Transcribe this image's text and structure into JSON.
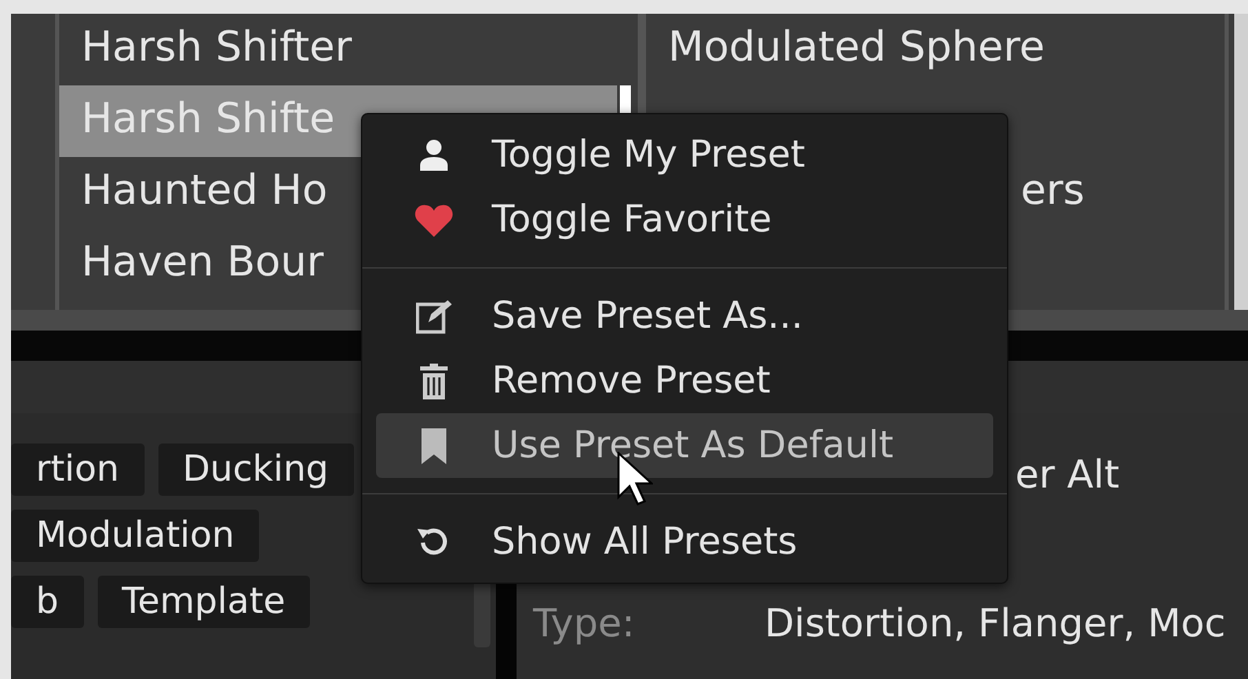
{
  "preset_list": {
    "columns": [
      {
        "items": [
          {
            "label": "Harsh Shifter",
            "selected": false
          },
          {
            "label": "Harsh Shifte",
            "selected": true
          },
          {
            "label": "Haunted Ho",
            "selected": false
          },
          {
            "label": "Haven Bour",
            "selected": false
          }
        ]
      },
      {
        "items": [
          {
            "label": "Modulated Sphere",
            "selected": false
          },
          {
            "label": "ers",
            "selected": false
          }
        ]
      }
    ]
  },
  "tags": [
    [
      "rtion",
      "Ducking"
    ],
    [
      "Modulation"
    ],
    [
      "b",
      "Template"
    ]
  ],
  "details": {
    "name": "er Alt",
    "type_label": "Type:",
    "type_value": "Distortion, Flanger, Moc"
  },
  "context_menu": {
    "items": [
      {
        "kind": "item",
        "label": "Toggle My Preset",
        "highlighted": false
      },
      {
        "kind": "item",
        "label": "Toggle Favorite",
        "highlighted": false
      },
      {
        "kind": "separator"
      },
      {
        "kind": "item",
        "label": "Save Preset As...",
        "highlighted": false
      },
      {
        "kind": "item",
        "label": "Remove Preset",
        "highlighted": false
      },
      {
        "kind": "item",
        "label": "Use Preset As Default",
        "highlighted": true
      },
      {
        "kind": "separator"
      },
      {
        "kind": "item",
        "label": "Show All Presets",
        "highlighted": false
      }
    ]
  }
}
